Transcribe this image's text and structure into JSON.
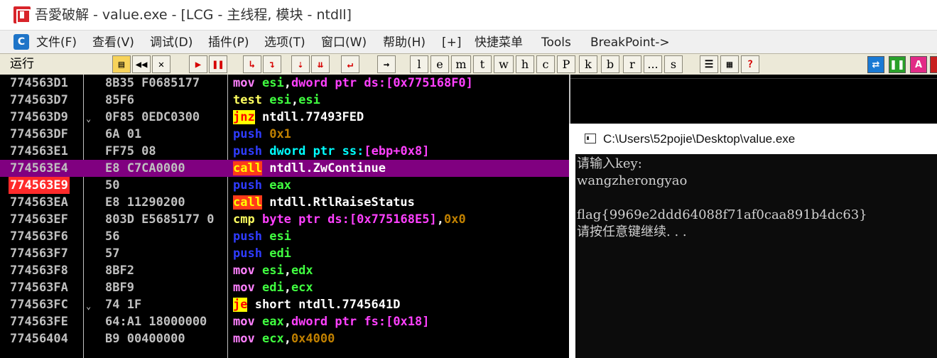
{
  "window": {
    "title": "吾愛破解 - value.exe - [LCG - 主线程, 模块 - ntdll]"
  },
  "menu": {
    "icon_letter": "C",
    "items": [
      "文件(F)",
      "查看(V)",
      "调试(D)",
      "插件(P)",
      "选项(T)",
      "窗口(W)",
      "帮助(H)",
      "[+]",
      "快捷菜单",
      "Tools",
      "BreakPoint->"
    ]
  },
  "toolbar": {
    "status": "运行",
    "letters": [
      "l",
      "e",
      "m",
      "t",
      "w",
      "h",
      "c",
      "P",
      "k",
      "b",
      "r",
      "...",
      "s"
    ],
    "help": "?",
    "right_badge": "A"
  },
  "disasm": {
    "rows": [
      {
        "addr": "774563D1",
        "hex": "8B35 F0685177",
        "asm": "mov esi,dword ptr ds:[0x775168F0]"
      },
      {
        "addr": "774563D7",
        "hex": "85F6",
        "asm": "test esi,esi"
      },
      {
        "addr": "774563D9",
        "arrow": "⌄",
        "hex": "0F85 0EDC0300",
        "asm": "jnz ntdll.77493FED"
      },
      {
        "addr": "774563DF",
        "hex": "6A 01",
        "asm": "push 0x1"
      },
      {
        "addr": "774563E1",
        "hex": "FF75 08",
        "asm": "push dword ptr ss:[ebp+0x8]"
      },
      {
        "addr": "774563E4",
        "hex": "E8 C7CA0000",
        "asm": "call ntdll.ZwContinue",
        "selected": true
      },
      {
        "addr": "774563E9",
        "hex": "50",
        "asm": "push eax",
        "breakpoint": true
      },
      {
        "addr": "774563EA",
        "hex": "E8 11290200",
        "asm": "call ntdll.RtlRaiseStatus"
      },
      {
        "addr": "774563EF",
        "hex": "803D E5685177 0",
        "asm": "cmp byte ptr ds:[0x775168E5],0x0"
      },
      {
        "addr": "774563F6",
        "hex": "56",
        "asm": "push esi"
      },
      {
        "addr": "774563F7",
        "hex": "57",
        "asm": "push edi"
      },
      {
        "addr": "774563F8",
        "hex": "8BF2",
        "asm": "mov esi,edx"
      },
      {
        "addr": "774563FA",
        "hex": "8BF9",
        "asm": "mov edi,ecx"
      },
      {
        "addr": "774563FC",
        "arrow": "⌄",
        "hex": "74 1F",
        "asm": "je short ntdll.7745641D"
      },
      {
        "addr": "774563FE",
        "hex": "64:A1 18000000",
        "asm": "mov eax,dword ptr fs:[0x18]"
      },
      {
        "addr": "77456404",
        "hex": "B9 00400000",
        "asm": "mov ecx,0x4000"
      }
    ]
  },
  "console": {
    "title": "C:\\Users\\52pojie\\Desktop\\value.exe",
    "lines": [
      "请输入key:",
      "wangzherongyao",
      "",
      "flag{9969e2ddd64088f71af0caa891b4dc63}",
      "请按任意键继续. . ."
    ]
  },
  "colors": {
    "selected_row": "#800080",
    "breakpoint": "#ff2a2a",
    "call_bg": "#ff3b1a",
    "jump_bg": "#ffff00",
    "push": "#2f3cff",
    "mov": "#ff80ff"
  }
}
